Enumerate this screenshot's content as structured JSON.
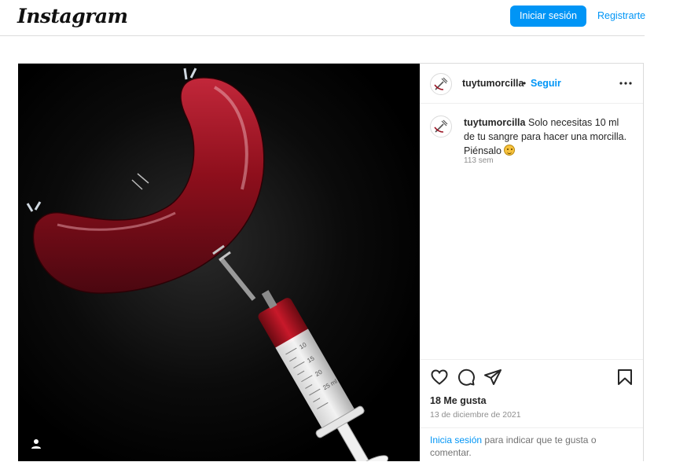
{
  "header": {
    "logo": "Instagram",
    "login_button": "Iniciar sesión",
    "signup_link": "Registrarte"
  },
  "post": {
    "username": "tuytumorcilla",
    "separator": "•",
    "follow_label": "Seguir",
    "caption_user": "tuytumorcilla",
    "caption_text": "Solo necesitas 10 ml de tu sangre para hacer una morcilla. Piénsalo",
    "caption_emoji": "smiling-face-icon",
    "time_ago": "113 sem",
    "likes": "18 Me gusta",
    "date": "13 de diciembre de 2021",
    "login_prompt_link": "Inicia sesión",
    "login_prompt_text": "para indicar que te gusta o comentar."
  },
  "media": {
    "syringe_marks": [
      "10",
      "15",
      "20",
      "25 ml"
    ],
    "colors": {
      "sausage": "#8e0f1c",
      "background": "#000000",
      "accent": "#0095f6"
    }
  },
  "icons": {
    "more": "more-options-icon",
    "like": "heart-icon",
    "comment": "comment-icon",
    "share": "share-icon",
    "save": "bookmark-icon",
    "tag": "user-tag-icon"
  }
}
